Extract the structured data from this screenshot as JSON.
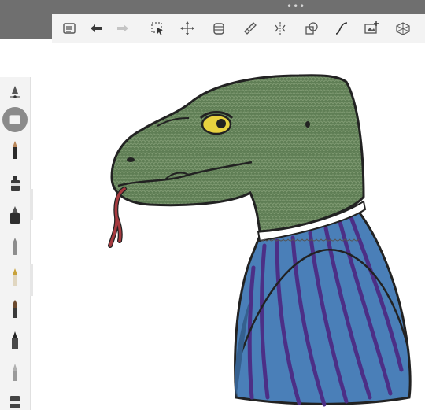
{
  "app": {
    "handle_dots": "•••"
  },
  "toolbar": {
    "items": [
      {
        "icon": "list-icon"
      },
      {
        "icon": "undo-icon"
      },
      {
        "icon": "redo-icon"
      },
      {
        "icon": "selection-icon"
      },
      {
        "icon": "transform-icon"
      },
      {
        "icon": "layers-icon"
      },
      {
        "icon": "ruler-icon"
      },
      {
        "icon": "symmetry-icon"
      },
      {
        "icon": "shapes-icon"
      },
      {
        "icon": "curve-icon"
      },
      {
        "icon": "add-image-icon"
      },
      {
        "icon": "perspective-icon"
      }
    ]
  },
  "sidebar": {
    "tools": [
      {
        "icon": "brush-size-icon"
      },
      {
        "icon": "color-swatch-icon"
      },
      {
        "icon": "pencil-icon"
      },
      {
        "icon": "marker-icon"
      },
      {
        "icon": "ink-pen-icon"
      },
      {
        "icon": "airbrush-icon"
      },
      {
        "icon": "fountain-pen-icon"
      },
      {
        "icon": "paint-brush-icon"
      },
      {
        "icon": "brush-pen-icon"
      },
      {
        "icon": "smudge-icon"
      },
      {
        "icon": "eraser-icon"
      }
    ]
  },
  "canvas": {
    "subject": "lizard-in-striped-shirt-drawing"
  },
  "colors": {
    "skin": "#5f7e55",
    "outline": "#222222",
    "shirt": "#4a7fb8",
    "stripe": "#4c2f86",
    "tongue": "#a53a3f",
    "eye": "#e8d23f",
    "topbar": "#6f6f6f",
    "toolbar_bg": "#f3f3f3"
  }
}
